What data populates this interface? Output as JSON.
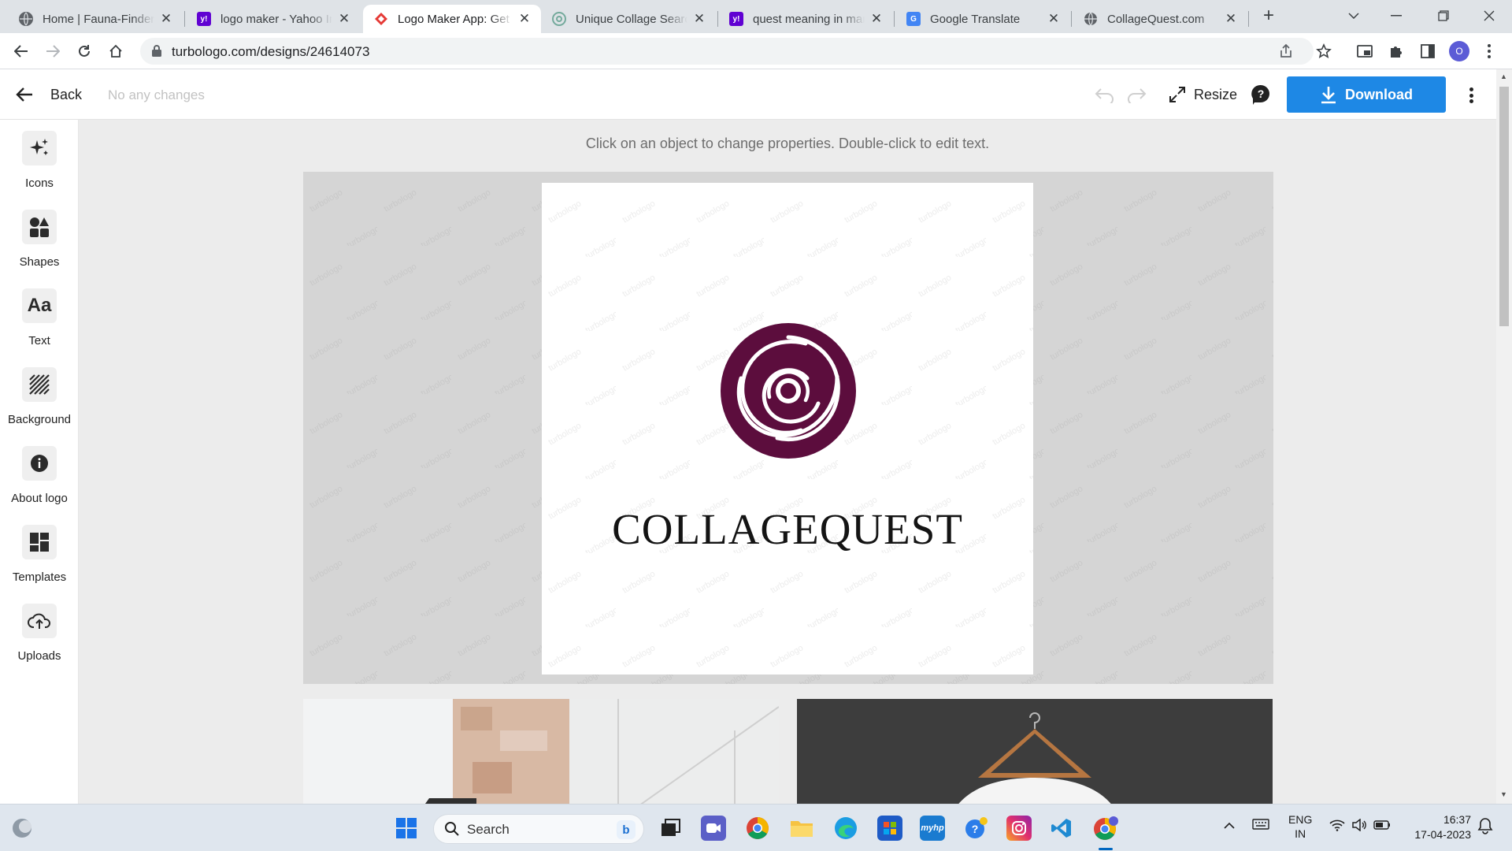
{
  "browser": {
    "tabs": [
      {
        "title": "Home | Fauna-Finder.com",
        "favicon": "globe-icon",
        "active": false
      },
      {
        "title": "logo maker - Yahoo India Search Results",
        "favicon": "yahoo-icon",
        "active": false
      },
      {
        "title": "Logo Maker App: Get Logo Design Ideas",
        "favicon": "turbologo-icon",
        "active": true
      },
      {
        "title": "Unique Collage Search Name",
        "favicon": "chatgpt-icon",
        "active": false
      },
      {
        "title": "quest meaning in marathi",
        "favicon": "yahoo-icon",
        "active": false
      },
      {
        "title": "Google Translate",
        "favicon": "google-translate-icon",
        "active": false
      },
      {
        "title": "CollageQuest.com",
        "favicon": "globe-icon",
        "active": false
      }
    ],
    "url": "turbologo.com/designs/24614073",
    "profile_initial": "O"
  },
  "header": {
    "back_label": "Back",
    "changes_status": "No any changes",
    "resize_label": "Resize",
    "download_label": "Download"
  },
  "sidebar": {
    "tools": [
      {
        "label": "Icons",
        "icon": "sparkles-icon"
      },
      {
        "label": "Shapes",
        "icon": "shapes-icon"
      },
      {
        "label": "Text",
        "icon": "text-aa-icon"
      },
      {
        "label": "Background",
        "icon": "background-stripes-icon"
      },
      {
        "label": "About logo",
        "icon": "info-icon"
      },
      {
        "label": "Templates",
        "icon": "templates-grid-icon"
      },
      {
        "label": "Uploads",
        "icon": "upload-cloud-icon"
      }
    ]
  },
  "canvas": {
    "hint": "Click on an object to change properties. Double-click to edit text.",
    "logo_text": "COLLAGEQUEST",
    "watermark_text": "turbologo",
    "logo_color": "#5c0d3d"
  },
  "taskbar": {
    "search_placeholder": "Search",
    "language_line1": "ENG",
    "language_line2": "IN",
    "time": "16:37",
    "date": "17-04-2023"
  },
  "colors": {
    "accent": "#1e88e5",
    "logo_mark": "#5c0d3d"
  }
}
